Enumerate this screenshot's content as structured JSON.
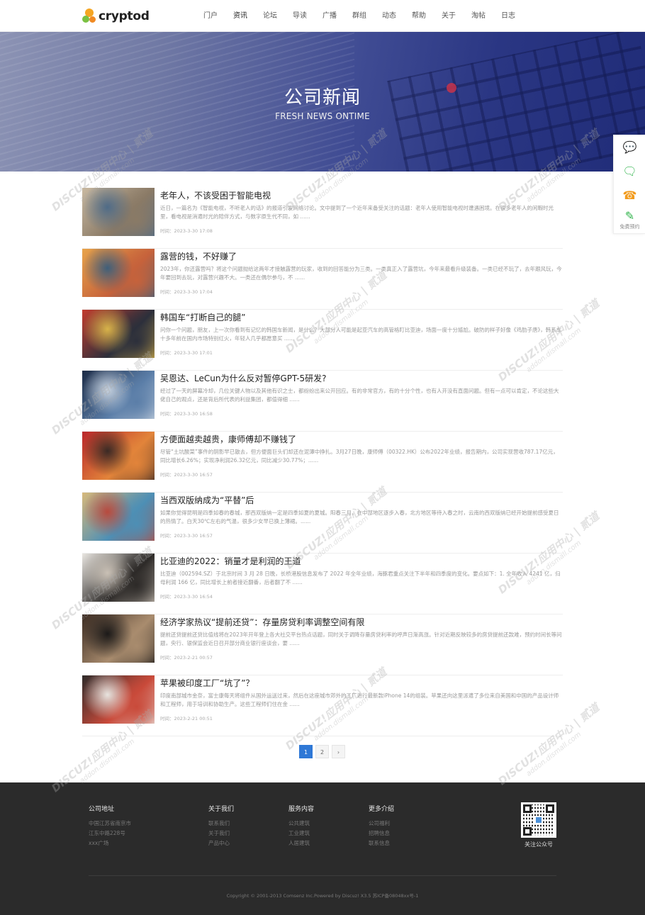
{
  "header": {
    "logo_text": "cryptod",
    "nav": [
      "门户",
      "资讯",
      "论坛",
      "导读",
      "广播",
      "群组",
      "动态",
      "帮助",
      "关于",
      "淘帖",
      "日志"
    ],
    "active_nav": "资讯"
  },
  "banner": {
    "title": "公司新闻",
    "subtitle": "FRESH NEWS ONTIME"
  },
  "side_float": {
    "items": [
      {
        "icon": "chat-icon",
        "label": ""
      },
      {
        "icon": "wechat-icon",
        "label": ""
      },
      {
        "icon": "phone-icon",
        "label": ""
      },
      {
        "icon": "edit-icon",
        "label": "免费预约"
      }
    ]
  },
  "news": [
    {
      "title": "老年人，不该受困于智能电视",
      "summary": "近日，一篇名为《智能电视，不听老人的话》的报道引发网络讨论。文中提到了一个近年来备受关注的话题：老年人使用智能电视时遭遇困境。在很多老年人的闲暇时光里，看电视是消遣时光的陪伴方式，与数字原生代不同，如 ......",
      "time": "时间：2023-3-30 17:08",
      "thumb_colors": [
        "#c9b9a1",
        "#8a7a66",
        "#4f6b87"
      ]
    },
    {
      "title": "露营的钱，不好赚了",
      "summary": "2023年，你还露营吗？将这个问题抛给这两年才接触露营的玩家，收到的回答能分为三类。一类真正入了露营坑，今年来最看升级装备。一类已经不玩了，去年跟风玩，今年要回到去玩，对露营兴趣不大。一类还在偶尔参与，不 ......",
      "time": "时间：2023-3-30 17:04",
      "thumb_colors": [
        "#e8a34a",
        "#c6623b",
        "#3f5f7a"
      ]
    },
    {
      "title": "韩国车“打断自己的腿”",
      "summary": "问你一个问题，朋友，上一次你看到有记忆的韩国车新闻，是什么？大部分人可能是起亚汽车的高管格盯比亚迪，场面一度十分尴尬。破防的样子好像《鸡肋子唐》，韩系车十多年前在国内市场特别红火，年轻人几乎都愿意买 ......",
      "time": "时间：2023-3-30 17:01",
      "thumb_colors": [
        "#c23b2e",
        "#2c2f3b",
        "#d7b34a"
      ]
    },
    {
      "title": "吴恩达、LeCun为什么反对暂停GPT-5研发?",
      "summary": "经过了一天的屏幕冷却，几位关键人物以及其他有识之士，都纷纷出来公开回应。有的非常官方，有的十分个性，也有人开没有直面问题。但有一点可以肯定，不论这些大佬自己的观点，还是背后所代表的利益集团，都值得细 ......",
      "time": "时间：2023-3-30 16:58",
      "thumb_colors": [
        "#1b2a45",
        "#5b7ea8",
        "#c8d3e0"
      ]
    },
    {
      "title": "方便面越卖越贵，康师傅却不赚钱了",
      "summary": "尽管“土坑酸菜”事件的阴影早已散去，但方便面巨头们却还在泥潭中挣扎。3月27日晚，康师傅（00322.HK）公布2022年业绩，报告期内，公司实现营收787.17亿元，同比增长6.26%；实现净利润26.32亿元，同比减少30.77%；......",
      "time": "时间：2023-3-30 16:57",
      "thumb_colors": [
        "#b9262b",
        "#e2843a",
        "#3a2a25"
      ]
    },
    {
      "title": "当西双版纳成为“平替”后",
      "summary": "如果你觉得昆明是四季如春的春城，那西双版纳一定是四季如夏的夏城。阳春三月，在中部地区逐步入春，北方地区等待入春之时，云南的西双版纳已经开始提前感受夏日的热情了。白天30℃左右的气温，很多少女早已换上薄裙。......",
      "time": "时间：2023-3-30 16:57",
      "thumb_colors": [
        "#d8b97a",
        "#4d8fb5",
        "#b84a3e"
      ]
    },
    {
      "title": "比亚迪的2022：销量才是利润的王道",
      "summary": "比亚迪（002594.SZ）于北京时间 3 月 28 日晚，长桥港股信息发布了 2022 年全年业绩，海豚君重点关注下半年和四季度的变化。要点如下：1. 全年收入 4241 亿，归母利润 166 亿，同比增长上前者接近翻番，后者翻了不 ......",
      "time": "时间：2023-3-30 16:54",
      "thumb_colors": [
        "#e9e6e1",
        "#2d2a28",
        "#c9c0b5"
      ]
    },
    {
      "title": "经济学家热议“提前还贷”：存量房贷利率调整空间有限",
      "summary": "提前还贷提前还贷比值线将在2023年开年登上各大社交平台热点话题，同时关于调降存量房贷利率的呼声日渐高涨。针对近期反映较多的房贷提前还款难，预约时间长等问题，央行、银保监会近日召开部分商业银行座谈会，要 ......",
      "time": "时间：2023-2-21 00:57",
      "thumb_colors": [
        "#3b2b22",
        "#a98c6e",
        "#1c1a19"
      ]
    },
    {
      "title": "苹果被印度工厂“坑了”？",
      "summary": "印度南部城市金奈，富士康每天将组件从国外运送过来，然后在这座城市郊外的工厂进行最新款iPhone 14的组装。苹果还向这里派遣了多位来自美国和中国的产品设计师和工程师，用于培训和协助生产。这些工程师们住在金 ......",
      "time": "时间：2023-2-21 00:51",
      "thumb_colors": [
        "#2e2b2a",
        "#c94a3a",
        "#e8e4df"
      ]
    }
  ],
  "pagination": {
    "pages": [
      "1",
      "2"
    ],
    "current": "1",
    "next": "›"
  },
  "footer": {
    "columns": [
      {
        "title": "公司地址",
        "lines": [
          "中国江苏省南京市",
          "江东中路228号",
          "xxx广场"
        ]
      },
      {
        "title": "关于我们",
        "lines": [
          "联系我们",
          "关于我们",
          "产品中心"
        ]
      },
      {
        "title": "服务内容",
        "lines": [
          "公共建筑",
          "工业建筑",
          "人居建筑"
        ]
      },
      {
        "title": "更多介绍",
        "lines": [
          "公司福利",
          "招聘信息",
          "联系信息"
        ]
      }
    ],
    "qr_label": "关注公众号",
    "copyright": "Copyright © 2001-2013 Comsenz Inc.Powered by Discuz! X3.5 苏ICP备08048xx号-1"
  },
  "watermark": {
    "line1": "DISCUZ!应用中心 | 贰道",
    "line2": "addon.dismall.com"
  }
}
